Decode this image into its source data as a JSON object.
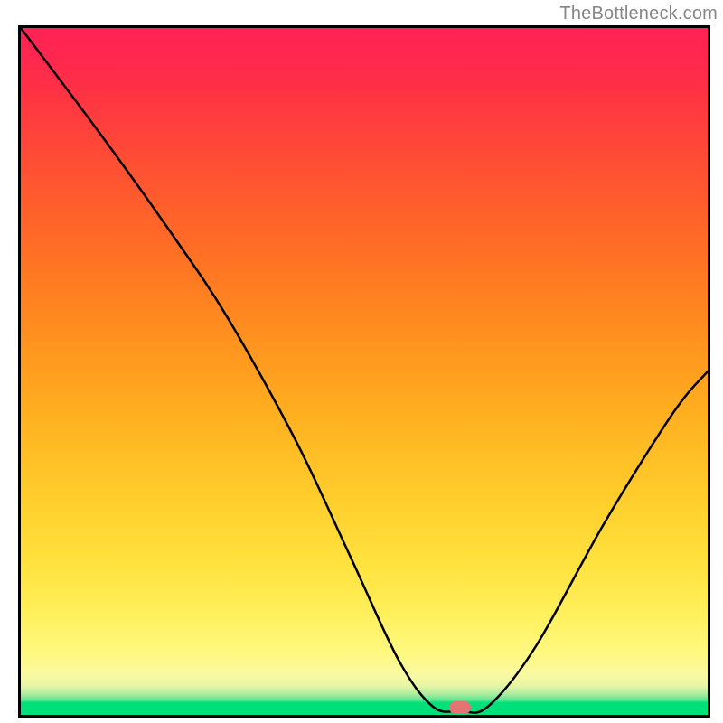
{
  "watermark_text": "TheBottleneck.com",
  "marker_color": "#e57373",
  "chart_data": {
    "type": "line",
    "title": "",
    "xlabel": "",
    "ylabel": "",
    "xlim": [
      0,
      100
    ],
    "ylim": [
      0,
      100
    ],
    "curve": [
      {
        "x": 0,
        "y": 100
      },
      {
        "x": 12,
        "y": 84
      },
      {
        "x": 22,
        "y": 70
      },
      {
        "x": 30,
        "y": 58
      },
      {
        "x": 40,
        "y": 40
      },
      {
        "x": 48,
        "y": 23
      },
      {
        "x": 55,
        "y": 8
      },
      {
        "x": 60,
        "y": 1.2
      },
      {
        "x": 64,
        "y": 0.6
      },
      {
        "x": 68,
        "y": 1.2
      },
      {
        "x": 75,
        "y": 10
      },
      {
        "x": 85,
        "y": 28
      },
      {
        "x": 95,
        "y": 44
      },
      {
        "x": 100,
        "y": 50
      }
    ],
    "marker_x": 64,
    "marker_y": 1.0
  }
}
